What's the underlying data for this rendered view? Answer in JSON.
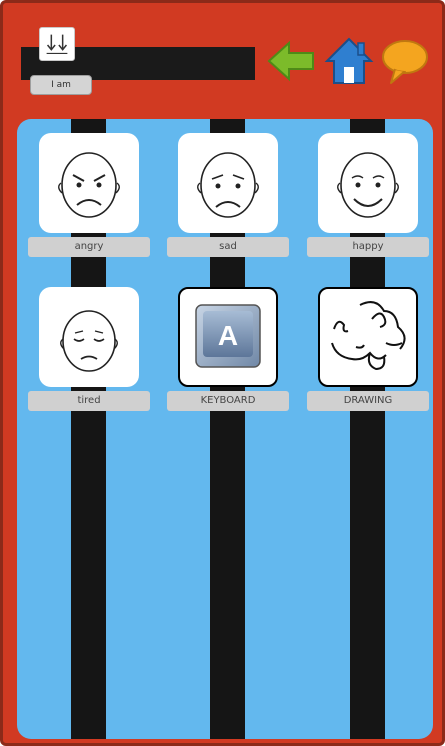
{
  "header": {
    "sentence_label": "I am",
    "sentence_text": "",
    "sentence_icon": "arrows-down-icon",
    "buttons": [
      {
        "icon": "back-arrow-icon",
        "color": "#7cbb2a"
      },
      {
        "icon": "home-icon",
        "color": "#2f7fd0"
      },
      {
        "icon": "speech-bubble-icon",
        "color": "#f4a51f"
      }
    ]
  },
  "colors": {
    "frame": "#d13a22",
    "panel": "#63b8ee",
    "stripe": "#151515",
    "label_bg": "#d0d0d0"
  },
  "tiles": [
    {
      "label": "angry",
      "icon": "angry-face-icon"
    },
    {
      "label": "sad",
      "icon": "sad-face-icon"
    },
    {
      "label": "happy",
      "icon": "happy-face-icon"
    },
    {
      "label": "tired",
      "icon": "tired-face-icon"
    },
    {
      "label": "KEYBOARD",
      "icon": "keyboard-key-icon",
      "key_letter": "A"
    },
    {
      "label": "DRAWING",
      "icon": "drawing-icon"
    }
  ]
}
